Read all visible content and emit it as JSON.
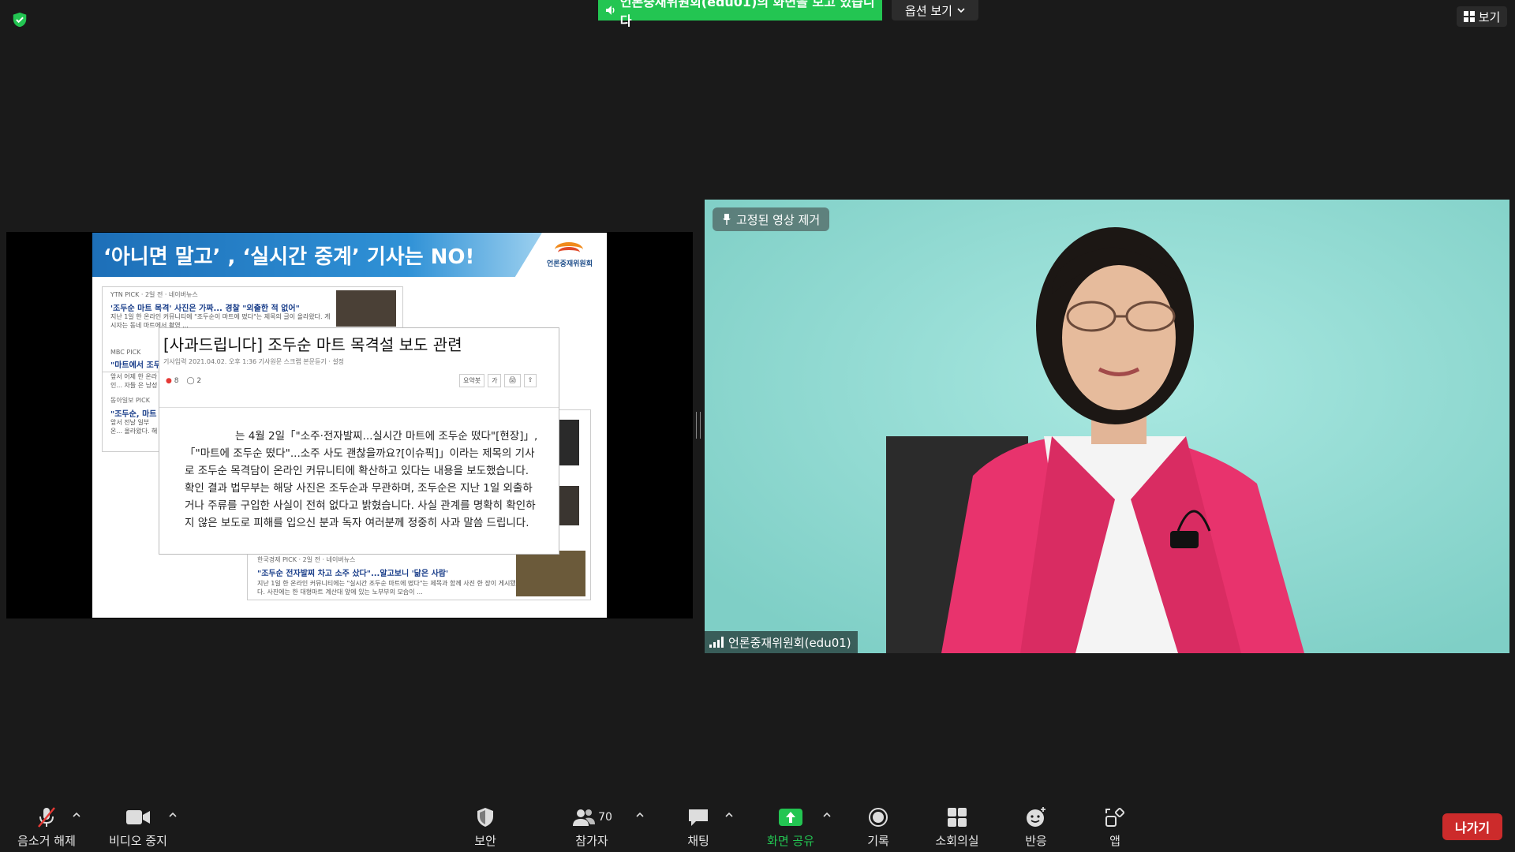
{
  "top": {
    "share_banner": "언론중재위원회(edu01)의 화면을 보고 있습니다",
    "view_options": "옵션 보기",
    "view": "보기"
  },
  "slide": {
    "header": "‘아니면 말고’ , ‘실시간 중계’ 기사는 NO!",
    "logo_text": "언론중재위원회",
    "news": [
      {
        "source": "YTN PICK · 2일 전 · 네이버뉴스",
        "headline": "'조두순 마트 목격' 사진은 가짜... 경찰 \"외출한 적 없어\"",
        "text": "지난 1일 한 온라인 커뮤니티에 \"조두순이 마트에 떴다\"는 제목의 글이 올라왔다. 게시자는 동네 마트에서 촬영 ..."
      },
      {
        "source": "MBC PICK",
        "headline": "\"마트에서 조두...",
        "text": "앞서 어제 한 온라인... 자들 은 낭성과 부..."
      },
      {
        "source": "동아일보 PICK",
        "headline": "\"조두순, 마트 ...",
        "text": "앞서 전날 일부 온... 올라왔다. 해당 글..."
      },
      {
        "source": "한국경제 PICK · 2일 전 · 네이버뉴스",
        "headline": "\"조두순 전자발찌 차고 소주 샀다\"...알고보니 '닮은 사람'",
        "text": "지난 1일 한 온라인 커뮤니티에는 \"실시간 조두순 마트에 떴다\"는 제목과 함께 사진 한 장이 게시됐다. 사진에는 한 대형마트 계산대 앞에 있는 노부부의 모습이 ..."
      }
    ],
    "popup": {
      "title": "[사과드립니다] 조두순 마트 목격설 보도 관련",
      "meta": "기사입력 2021.04.02. 오후 1:36  기사원문  스크랩  본문듣기 · 설정",
      "reactions": "8",
      "comments": "2",
      "tools": [
        "요약봇",
        "가",
        "🖨",
        "⇪"
      ],
      "body": "는 4월 2일「\"소주·전자발찌...실시간 마트에 조두순 떴다\"[현장]」,「\"마트에 조두순 떴다\"...소주 사도 괜찮을까요?[이슈픽]」이라는 제목의 기사로 조두순 목격담이 온라인 커뮤니티에 확산하고 있다는 내용을 보도했습니다. 확인 결과 법무부는 해당 사진은 조두순과 무관하며, 조두순은 지난 1일 외출하거나 주류를 구입한 사실이 전혀 없다고 밝혔습니다. 사실 관계를 명확히 확인하지 않은 보도로 피해를 입으신 분과 독자 여러분께 정중히 사과 말씀 드립니다."
    }
  },
  "video": {
    "pinned": "고정된 영상 제거",
    "name": "언론중재위원회(edu01)"
  },
  "toolbar": {
    "unmute": "음소거 해제",
    "video": "비디오 중지",
    "security": "보안",
    "participants": "참가자",
    "participant_count": "70",
    "chat": "채팅",
    "share": "화면 공유",
    "record": "기록",
    "breakout": "소회의실",
    "reactions": "반응",
    "apps": "앱",
    "leave": "나가기"
  },
  "colors": {
    "accent_green": "#23c552",
    "leave_red": "#cc2b2b"
  }
}
